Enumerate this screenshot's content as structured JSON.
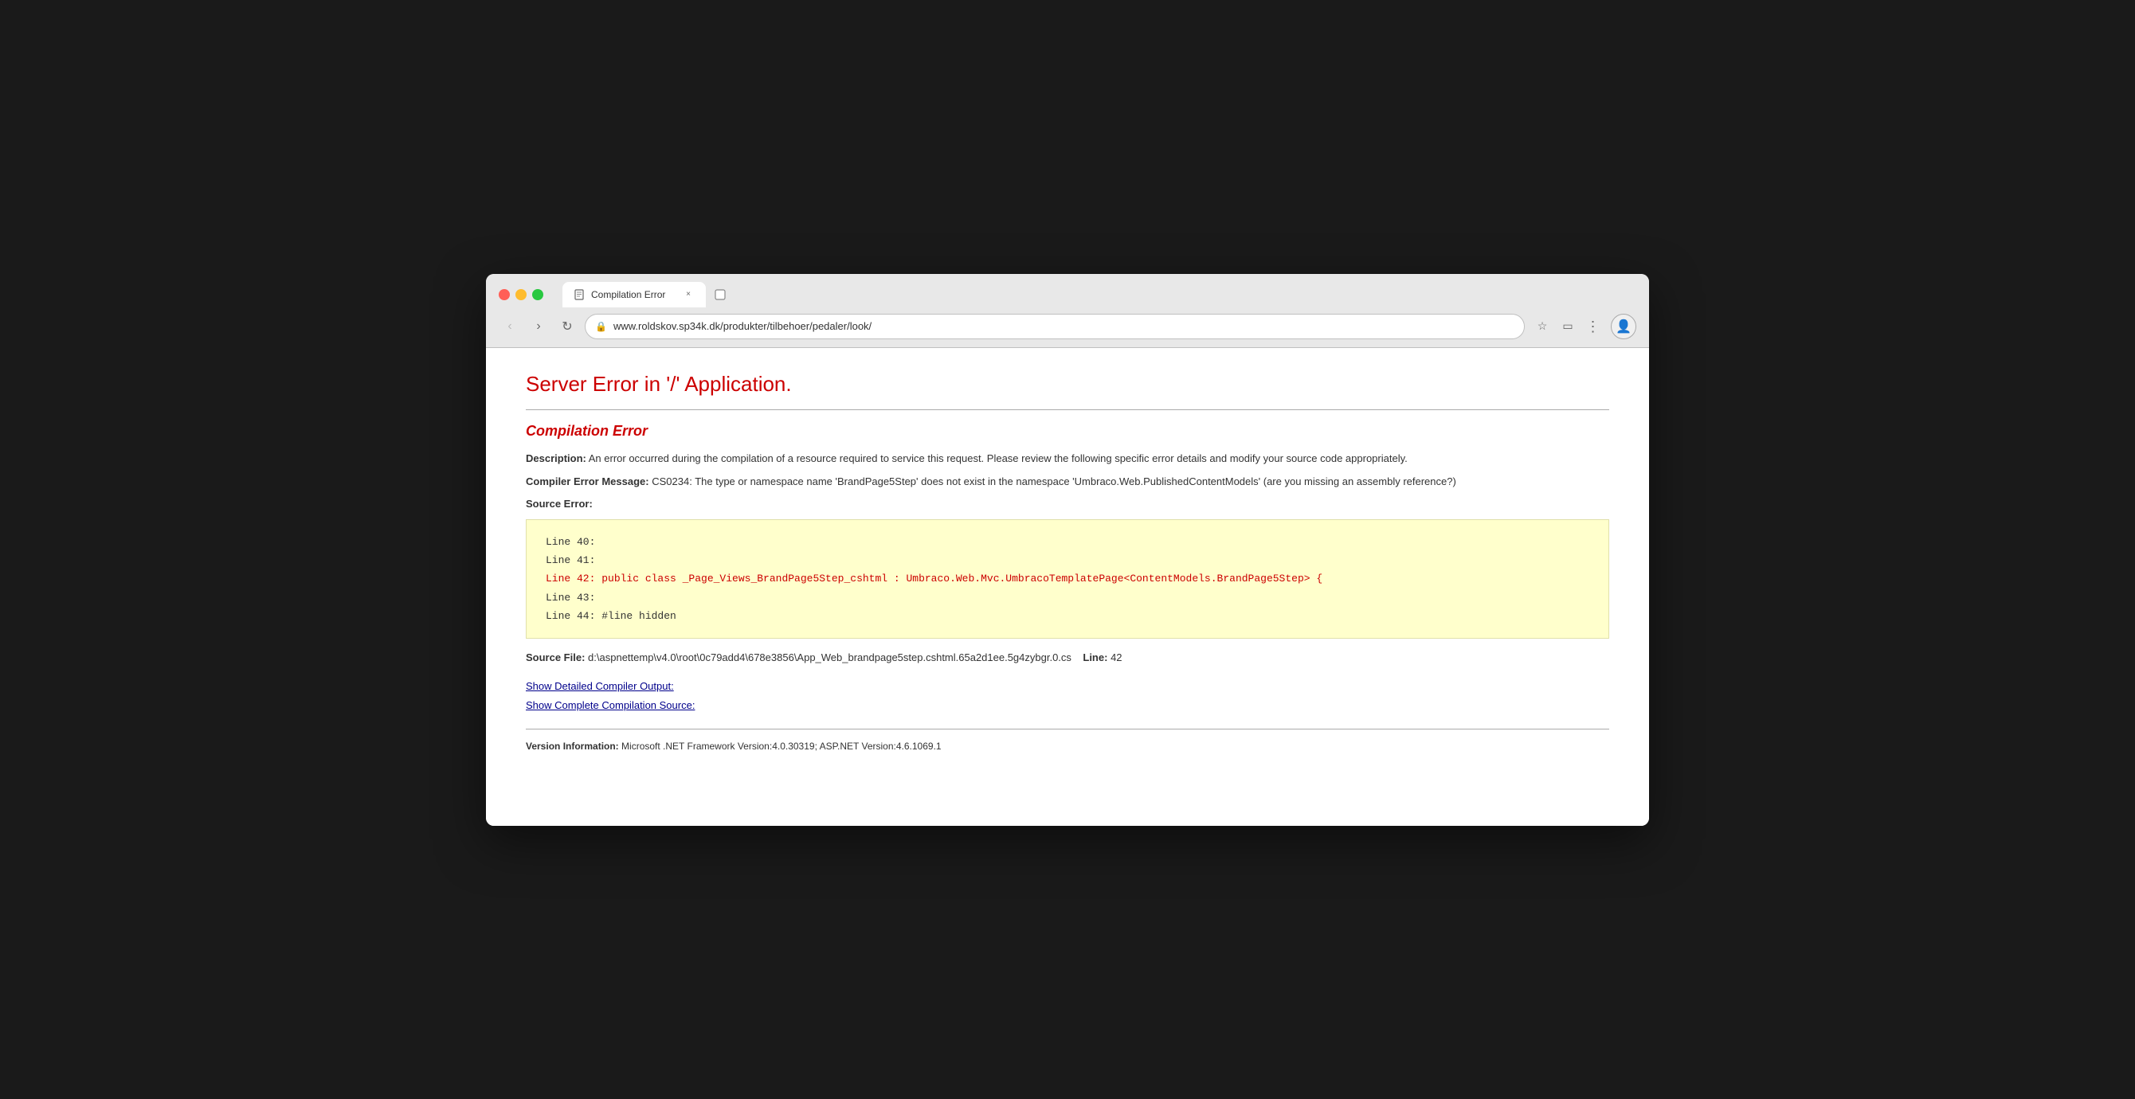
{
  "browser": {
    "controls": {
      "close_label": "×",
      "min_label": "–",
      "max_label": "+"
    },
    "tab": {
      "title": "Compilation Error",
      "close_label": "×"
    },
    "new_tab_label": "+",
    "address_bar": {
      "url": "www.roldskov.sp34k.dk/produkter/tilbehoer/pedaler/look/",
      "lock_symbol": "🔒"
    },
    "nav": {
      "back_label": "‹",
      "forward_label": "›",
      "reload_label": "↻"
    }
  },
  "page": {
    "server_error_title": "Server Error in '/' Application.",
    "compilation_error_heading": "Compilation Error",
    "description_label": "Description:",
    "description_text": "An error occurred during the compilation of a resource required to service this request. Please review the following specific error details and modify your source code appropriately.",
    "compiler_error_label": "Compiler Error Message:",
    "compiler_error_text": "CS0234: The type or namespace name 'BrandPage5Step' does not exist in the namespace 'Umbraco.Web.PublishedContentModels' (are you missing an assembly reference?)",
    "source_error_label": "Source Error:",
    "code_lines": [
      {
        "text": "Line 40:",
        "error": false
      },
      {
        "text": "Line 41:",
        "error": false
      },
      {
        "text": "Line 42:      public class _Page_Views_BrandPage5Step_cshtml : Umbraco.Web.Mvc.UmbracoTemplatePage<ContentModels.BrandPage5Step> {",
        "error": true
      },
      {
        "text": "Line 43:",
        "error": false
      },
      {
        "text": "Line 44: #line hidden",
        "error": false
      }
    ],
    "source_file_label": "Source File:",
    "source_file_path": "d:\\aspnettemp\\v4.0\\root\\0c79add4\\678e3856\\App_Web_brandpage5step.cshtml.65a2d1ee.5g4zybgr.0.cs",
    "line_label": "Line:",
    "line_number": "42",
    "links": [
      {
        "text": "Show Detailed Compiler Output:"
      },
      {
        "text": "Show Complete Compilation Source:"
      }
    ],
    "version_label": "Version Information:",
    "version_text": "Microsoft .NET Framework Version:4.0.30319; ASP.NET Version:4.6.1069.1"
  }
}
